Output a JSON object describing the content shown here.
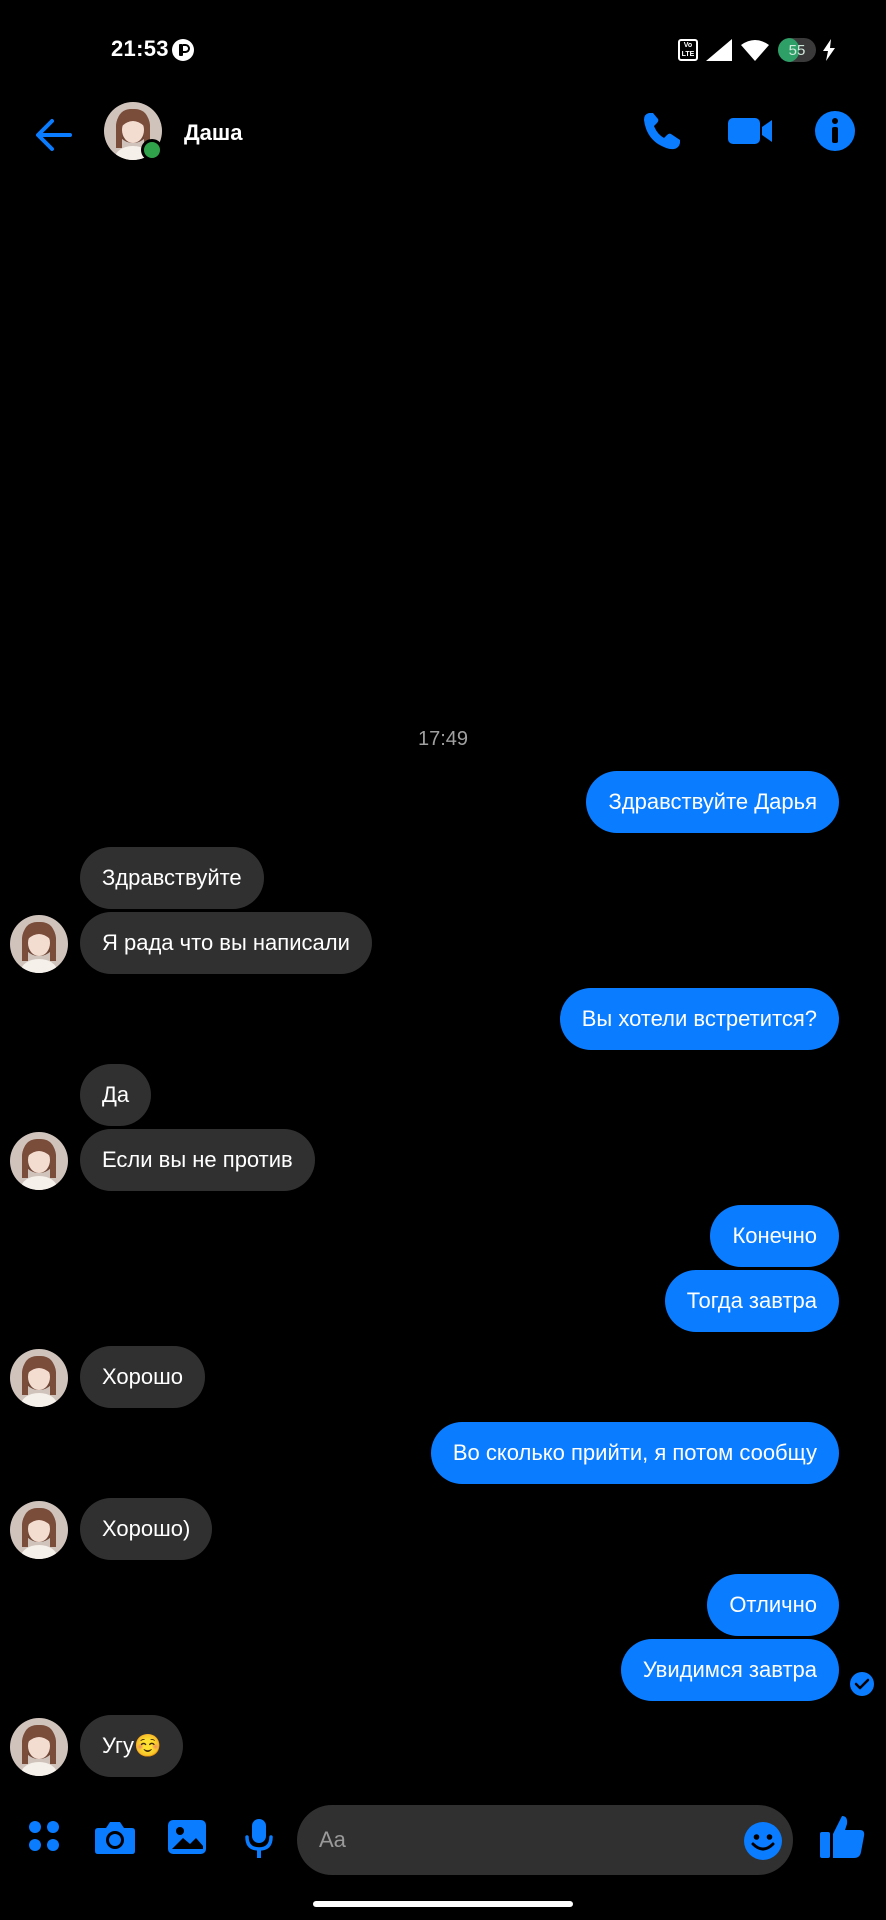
{
  "status_bar": {
    "time": "21:53",
    "volte_label": "Vo LTE",
    "battery_level": "55",
    "battery_fraction": 0.55,
    "icons": [
      "app-notification-icon",
      "volte-icon",
      "signal-icon",
      "wifi-icon",
      "battery-icon",
      "charging-bolt-icon"
    ]
  },
  "header": {
    "contact_name": "Даша",
    "online": true,
    "icons": [
      "back-arrow-icon",
      "phone-call-icon",
      "video-call-icon",
      "info-icon"
    ],
    "accent_color": "#0a7cff"
  },
  "conversation": {
    "timestamp": "17:49",
    "messages": [
      {
        "from": "me",
        "text": "Здравствуйте Дарья"
      },
      {
        "from": "them",
        "text": "Здравствуйте"
      },
      {
        "from": "them",
        "text": "Я рада что вы написали"
      },
      {
        "from": "me",
        "text": "Вы хотели встретится?"
      },
      {
        "from": "them",
        "text": "Да"
      },
      {
        "from": "them",
        "text": "Если вы не против"
      },
      {
        "from": "me",
        "text": "Конечно"
      },
      {
        "from": "me",
        "text": "Тогда завтра"
      },
      {
        "from": "them",
        "text": "Хорошо"
      },
      {
        "from": "me",
        "text": "Во сколько прийти, я потом сообщу"
      },
      {
        "from": "them",
        "text": "Хорошо)"
      },
      {
        "from": "me",
        "text": "Отлично"
      },
      {
        "from": "me",
        "text": "Увидимся завтра"
      },
      {
        "from": "them",
        "text": "Угу☺️"
      }
    ],
    "outgoing_color": "#0a7cff",
    "incoming_color": "#303030"
  },
  "composer": {
    "placeholder": "Aa",
    "icons": [
      "apps-grid-icon",
      "camera-icon",
      "gallery-image-icon",
      "microphone-icon",
      "emoji-icon",
      "thumbs-up-icon"
    ]
  }
}
